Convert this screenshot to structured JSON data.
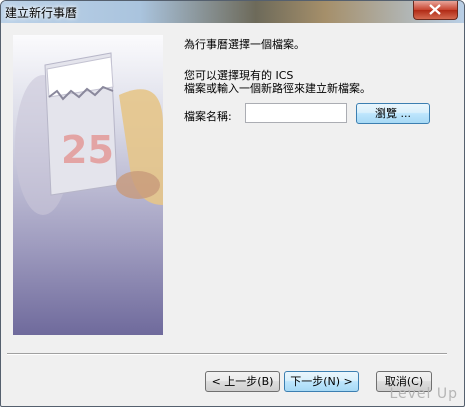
{
  "window": {
    "title": "建立新行事曆"
  },
  "main": {
    "heading": "為行事曆選擇一個檔案。",
    "desc_line1": "您可以選擇現有的 ICS",
    "desc_line2": "檔案或輸入一個新路徑來建立新檔案。",
    "filename_label": "檔案名稱:",
    "filename_value": "",
    "browse_label": "瀏覽 ...",
    "art_number": "25"
  },
  "footer": {
    "back_label": "< 上一步(B)",
    "next_label": "下一步(N) >",
    "cancel_label": "取消(C)"
  },
  "watermark": "Level Up",
  "colors": {
    "close_button": "#c7432e",
    "focus_border": "#3c7fb1"
  }
}
